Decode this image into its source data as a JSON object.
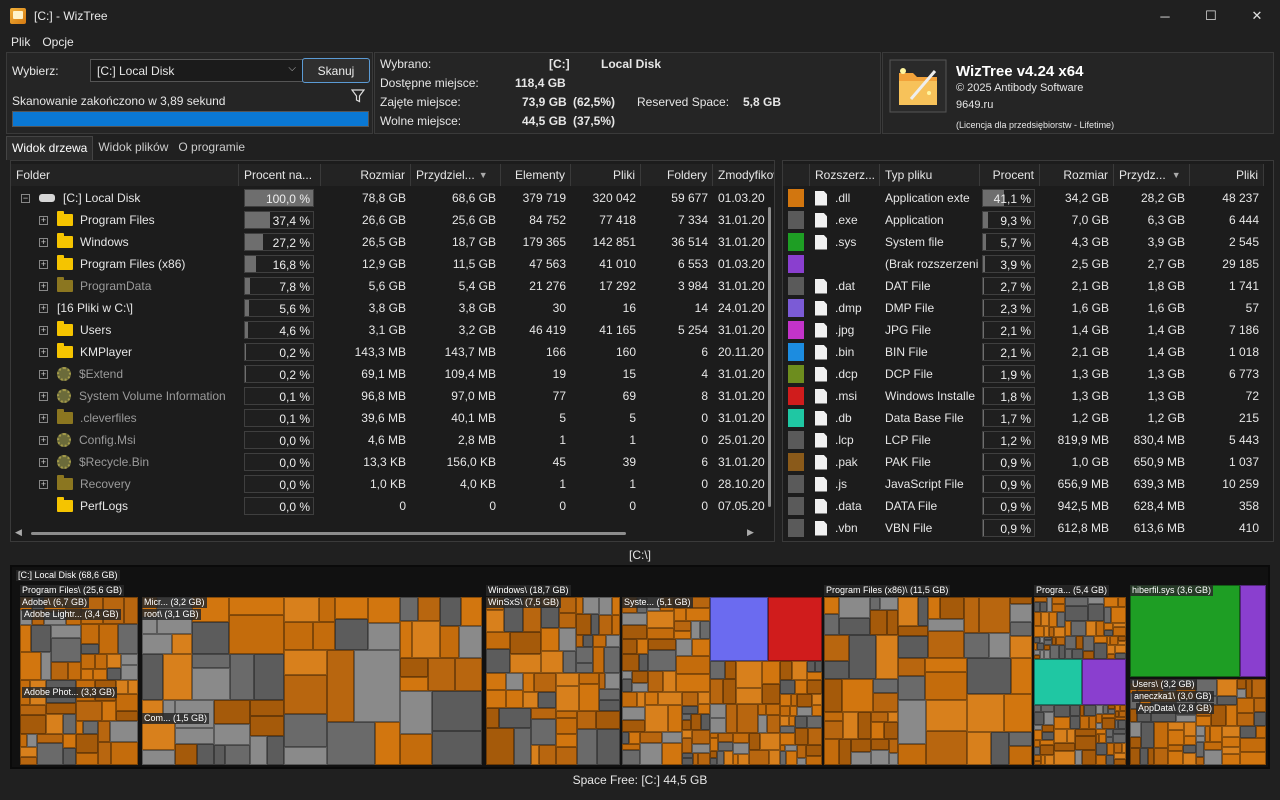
{
  "window": {
    "title": "[C:]  - WizTree",
    "min": "─",
    "max": "☐",
    "close": "✕"
  },
  "menu": [
    "Plik",
    "Opcje"
  ],
  "select": {
    "label": "Wybierz:",
    "drive": "[C:] Local Disk",
    "scan_button": "Skanuj",
    "status": "Skanowanie zakończono w 3,89 sekund",
    "progress": 1.0
  },
  "disk": {
    "selected_label": "Wybrano:",
    "selected_drive": "[C:]",
    "selected_name": "Local Disk",
    "available_label": "Dostępne miejsce:",
    "available": "118,4 GB",
    "used_label": "Zajęte miejsce:",
    "used": "73,9 GB",
    "used_pct": "(62,5%)",
    "reserved_label": "Reserved Space:",
    "reserved": "5,8 GB",
    "free_label": "Wolne miejsce:",
    "free": "44,5 GB",
    "free_pct": "(37,5%)"
  },
  "about": {
    "version": "WizTree v4.24 x64",
    "copyright": "© 2025 Antibody Software",
    "site": "9649.ru",
    "license": "(Licencja dla przedsiębiorstw - Lifetime)"
  },
  "tabs": [
    "Widok drzewa",
    "Widok plików",
    "O programie"
  ],
  "tree_headers": [
    "Folder",
    "Procent na...",
    "Rozmiar",
    "Przydziel...",
    "Elementy",
    "Pliki",
    "Foldery",
    "Zmodyfikow"
  ],
  "tree_rows": [
    {
      "name": "[C:] Local Disk",
      "icon": "disk-icon",
      "pct": "100,0 %",
      "pctv": 1.0,
      "size": "78,8 GB",
      "alloc": "68,6 GB",
      "items": "379 719",
      "files": "320 042",
      "folders": "59 677",
      "mod": "01.03.20"
    },
    {
      "name": "Program Files",
      "icon": "folder-icon",
      "pct": "37,4 %",
      "pctv": 0.374,
      "size": "26,6 GB",
      "alloc": "25,6 GB",
      "items": "84 752",
      "files": "77 418",
      "folders": "7 334",
      "mod": "31.01.20"
    },
    {
      "name": "Windows",
      "icon": "folder-icon",
      "pct": "27,2 %",
      "pctv": 0.272,
      "size": "26,5 GB",
      "alloc": "18,7 GB",
      "items": "179 365",
      "files": "142 851",
      "folders": "36 514",
      "mod": "31.01.20"
    },
    {
      "name": "Program Files (x86)",
      "icon": "folder-icon",
      "pct": "16,8 %",
      "pctv": 0.168,
      "size": "12,9 GB",
      "alloc": "11,5 GB",
      "items": "47 563",
      "files": "41 010",
      "folders": "6 553",
      "mod": "01.03.20"
    },
    {
      "name": "ProgramData",
      "icon": "folder-dim-icon",
      "pct": "7,8 %",
      "pctv": 0.078,
      "size": "5,6 GB",
      "alloc": "5,4 GB",
      "items": "21 276",
      "files": "17 292",
      "folders": "3 984",
      "mod": "31.01.20"
    },
    {
      "name": "[16 Pliki w C:\\]",
      "icon": "none",
      "pct": "5,6 %",
      "pctv": 0.056,
      "size": "3,8 GB",
      "alloc": "3,8 GB",
      "items": "30",
      "files": "16",
      "folders": "14",
      "mod": "24.01.20"
    },
    {
      "name": "Users",
      "icon": "folder-icon",
      "pct": "4,6 %",
      "pctv": 0.046,
      "size": "3,1 GB",
      "alloc": "3,2 GB",
      "items": "46 419",
      "files": "41 165",
      "folders": "5 254",
      "mod": "31.01.20"
    },
    {
      "name": "KMPlayer",
      "icon": "folder-icon",
      "pct": "0,2 %",
      "pctv": 0.002,
      "size": "143,3 MB",
      "alloc": "143,7 MB",
      "items": "166",
      "files": "160",
      "folders": "6",
      "mod": "20.11.20"
    },
    {
      "name": "$Extend",
      "icon": "gear-icon",
      "pct": "0,2 %",
      "pctv": 0.002,
      "size": "69,1 MB",
      "alloc": "109,4 MB",
      "items": "19",
      "files": "15",
      "folders": "4",
      "mod": "31.01.20"
    },
    {
      "name": "System Volume Information",
      "icon": "gear-icon",
      "pct": "0,1 %",
      "pctv": 0.001,
      "size": "96,8 MB",
      "alloc": "97,0 MB",
      "items": "77",
      "files": "69",
      "folders": "8",
      "mod": "31.01.20"
    },
    {
      "name": ".cleverfiles",
      "icon": "folder-dim-icon",
      "pct": "0,1 %",
      "pctv": 0.001,
      "size": "39,6 MB",
      "alloc": "40,1 MB",
      "items": "5",
      "files": "5",
      "folders": "0",
      "mod": "31.01.20"
    },
    {
      "name": "Config.Msi",
      "icon": "gear-icon",
      "pct": "0,0 %",
      "pctv": 0.0,
      "size": "4,6 MB",
      "alloc": "2,8 MB",
      "items": "1",
      "files": "1",
      "folders": "0",
      "mod": "25.01.20"
    },
    {
      "name": "$Recycle.Bin",
      "icon": "gear-icon",
      "pct": "0,0 %",
      "pctv": 0.0,
      "size": "13,3 KB",
      "alloc": "156,0 KB",
      "items": "45",
      "files": "39",
      "folders": "6",
      "mod": "31.01.20"
    },
    {
      "name": "Recovery",
      "icon": "folder-dim-icon",
      "pct": "0,0 %",
      "pctv": 0.0,
      "size": "1,0 KB",
      "alloc": "4,0 KB",
      "items": "1",
      "files": "1",
      "folders": "0",
      "mod": "28.10.20"
    },
    {
      "name": "PerfLogs",
      "icon": "folder-icon",
      "pct": "0,0 %",
      "pctv": 0.0,
      "size": "0",
      "alloc": "0",
      "items": "0",
      "files": "0",
      "folders": "0",
      "mod": "07.05.20"
    }
  ],
  "ext_headers": [
    "Rozszerz...",
    "Typ pliku",
    "Procent",
    "Rozmiar",
    "Przydz...",
    "Pliki"
  ],
  "ext_rows": [
    {
      "color": "#d2760f",
      "ext": ".dll",
      "type": "Application exte",
      "pct": "41,1 %",
      "pctv": 0.411,
      "size": "34,2 GB",
      "alloc": "28,2 GB",
      "files": "48 237"
    },
    {
      "color": "#5a5a5a",
      "ext": ".exe",
      "type": "Application",
      "pct": "9,3 %",
      "pctv": 0.093,
      "size": "7,0 GB",
      "alloc": "6,3 GB",
      "files": "6 444"
    },
    {
      "color": "#1e9e24",
      "ext": ".sys",
      "type": "System file",
      "pct": "5,7 %",
      "pctv": 0.057,
      "size": "4,3 GB",
      "alloc": "3,9 GB",
      "files": "2 545"
    },
    {
      "color": "#8a3fcf",
      "ext": "",
      "type": "(Brak rozszerzeni",
      "pct": "3,9 %",
      "pctv": 0.039,
      "size": "2,5 GB",
      "alloc": "2,7 GB",
      "files": "29 185"
    },
    {
      "color": "#5a5a5a",
      "ext": ".dat",
      "type": "DAT File",
      "pct": "2,7 %",
      "pctv": 0.027,
      "size": "2,1 GB",
      "alloc": "1,8 GB",
      "files": "1 741"
    },
    {
      "color": "#7b5bd6",
      "ext": ".dmp",
      "type": "DMP File",
      "pct": "2,3 %",
      "pctv": 0.023,
      "size": "1,6 GB",
      "alloc": "1,6 GB",
      "files": "57"
    },
    {
      "color": "#c233c9",
      "ext": ".jpg",
      "type": "JPG File",
      "pct": "2,1 %",
      "pctv": 0.021,
      "size": "1,4 GB",
      "alloc": "1,4 GB",
      "files": "7 186"
    },
    {
      "color": "#1c8ce0",
      "ext": ".bin",
      "type": "BIN File",
      "pct": "2,1 %",
      "pctv": 0.021,
      "size": "2,1 GB",
      "alloc": "1,4 GB",
      "files": "1 018"
    },
    {
      "color": "#6d8d1e",
      "ext": ".dcp",
      "type": "DCP File",
      "pct": "1,9 %",
      "pctv": 0.019,
      "size": "1,3 GB",
      "alloc": "1,3 GB",
      "files": "6 773"
    },
    {
      "color": "#d01c1c",
      "ext": ".msi",
      "type": "Windows Installe",
      "pct": "1,8 %",
      "pctv": 0.018,
      "size": "1,3 GB",
      "alloc": "1,3 GB",
      "files": "72"
    },
    {
      "color": "#1fc7a3",
      "ext": ".db",
      "type": "Data Base File",
      "pct": "1,7 %",
      "pctv": 0.017,
      "size": "1,2 GB",
      "alloc": "1,2 GB",
      "files": "215"
    },
    {
      "color": "#5a5a5a",
      "ext": ".lcp",
      "type": "LCP File",
      "pct": "1,2 %",
      "pctv": 0.012,
      "size": "819,9 MB",
      "alloc": "830,4 MB",
      "files": "5 443"
    },
    {
      "color": "#8a5a1a",
      "ext": ".pak",
      "type": "PAK File",
      "pct": "0,9 %",
      "pctv": 0.009,
      "size": "1,0 GB",
      "alloc": "650,9 MB",
      "files": "1 037"
    },
    {
      "color": "#5a5a5a",
      "ext": ".js",
      "type": "JavaScript File",
      "pct": "0,9 %",
      "pctv": 0.009,
      "size": "656,9 MB",
      "alloc": "639,3 MB",
      "files": "10 259"
    },
    {
      "color": "#5a5a5a",
      "ext": ".data",
      "type": "DATA File",
      "pct": "0,9 %",
      "pctv": 0.009,
      "size": "942,5 MB",
      "alloc": "628,4 MB",
      "files": "358"
    },
    {
      "color": "#5a5a5a",
      "ext": ".vbn",
      "type": "VBN File",
      "pct": "0,9 %",
      "pctv": 0.009,
      "size": "612,8 MB",
      "alloc": "613,6 MB",
      "files": "410"
    }
  ],
  "treemap": {
    "path": "[C:\\]",
    "root_label": "[C:] Local Disk  (68,6 GB)",
    "blocks": [
      {
        "label": "Program Files\\ (25,6 GB)"
      },
      {
        "label": "Adobe\\ (6,7 GB)"
      },
      {
        "label": "Adobe Lightr... (3,4 GB)"
      },
      {
        "label": "Adobe Phot... (3,3 GB)"
      },
      {
        "label": "Micr... (3,2 GB)"
      },
      {
        "label": "root\\ (3,1 GB)"
      },
      {
        "label": "Com... (1,5 GB)"
      },
      {
        "label": "Windows\\ (18,7 GB)"
      },
      {
        "label": "WinSxS\\ (7,5 GB)"
      },
      {
        "label": "Syste... (5,1 GB)"
      },
      {
        "label": "Program Files (x86)\\ (11,5 GB)"
      },
      {
        "label": "Progra... (5,4 GB)"
      },
      {
        "label": "hiberfil.sys (3,6 GB)"
      },
      {
        "label": "Users\\ (3,2 GB)"
      },
      {
        "label": "aneczka1\\ (3,0 GB)"
      },
      {
        "label": "AppData\\ (2,8 GB)"
      }
    ]
  },
  "status": "Space Free: [C:] 44,5 GB"
}
